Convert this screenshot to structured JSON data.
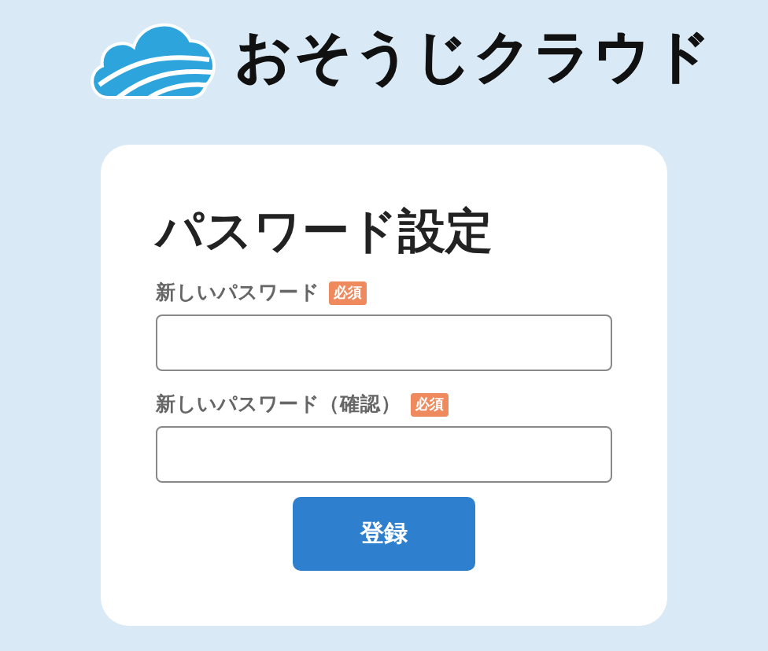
{
  "logo": {
    "text": "おそうじクラウド"
  },
  "form": {
    "title": "パスワード設定",
    "fields": [
      {
        "label": "新しいパスワード",
        "required_badge": "必須"
      },
      {
        "label": "新しいパスワード（確認）",
        "required_badge": "必須"
      }
    ],
    "submit": "登録"
  }
}
